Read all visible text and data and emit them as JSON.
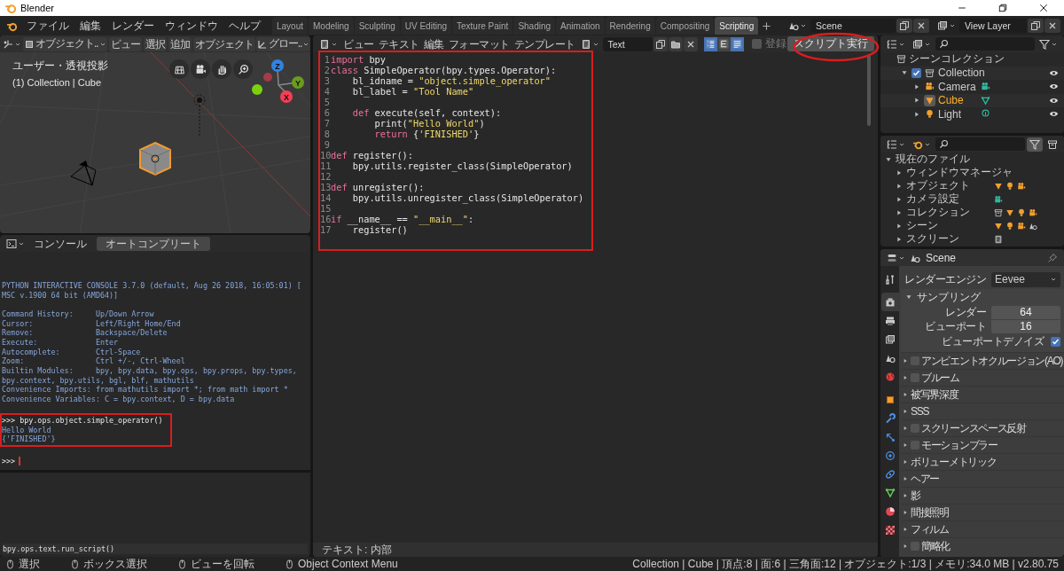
{
  "window": {
    "title": "Blender"
  },
  "menu": [
    "ファイル",
    "編集",
    "レンダー",
    "ウィンドウ",
    "ヘルプ"
  ],
  "workspace_tabs": [
    {
      "label": "Layout",
      "selected": false
    },
    {
      "label": "Modeling",
      "selected": false
    },
    {
      "label": "Sculpting",
      "selected": false
    },
    {
      "label": "UV Editing",
      "selected": false
    },
    {
      "label": "Texture Paint",
      "selected": false
    },
    {
      "label": "Shading",
      "selected": false
    },
    {
      "label": "Animation",
      "selected": false
    },
    {
      "label": "Rendering",
      "selected": false
    },
    {
      "label": "Compositing",
      "selected": false
    },
    {
      "label": "Scripting",
      "selected": true
    }
  ],
  "scene": {
    "value": "Scene"
  },
  "view_layer": {
    "value": "View Layer"
  },
  "viewport": {
    "mode": "オブジェクト..",
    "menu": [
      "ビュー",
      "選択",
      "追加",
      "オブジェクト"
    ],
    "orientation": "グロー..",
    "view_name": "ユーザー・透視投影",
    "context": "(1) Collection | Cube",
    "axes": [
      "Z",
      "Y",
      "X"
    ]
  },
  "console": {
    "menu": "コンソール",
    "button": "オートコンプリート",
    "banner": [
      "PYTHON INTERACTIVE CONSOLE 3.7.0 (default, Aug 26 2018, 16:05:01) [",
      "MSC v.1900 64 bit (AMD64)]"
    ],
    "help": [
      "Command History:     Up/Down Arrow",
      "Cursor:              Left/Right Home/End",
      "Remove:              Backspace/Delete",
      "Execute:             Enter",
      "Autocomplete:        Ctrl-Space",
      "Zoom:                Ctrl +/-, Ctrl-Wheel",
      "Builtin Modules:     bpy, bpy.data, bpy.ops, bpy.props, bpy.types,",
      "bpy.context, bpy.utils, bgl, blf, mathutils",
      "Convenience Imports: from mathutils import *; from math import *",
      "Convenience Variables: C = bpy.context, D = bpy.data"
    ],
    "output": [
      {
        "text": ">>> bpy.ops.object.simple_operator()",
        "kind": "input"
      },
      {
        "text": "Hello World",
        "kind": "output"
      },
      {
        "text": "{'FINISHED'}",
        "kind": "output"
      }
    ],
    "prompt": ">>>"
  },
  "info": {
    "report": "bpy.ops.text.run_script()"
  },
  "text_editor": {
    "menu": [
      "ビュー",
      "テキスト",
      "編集",
      "フォーマット",
      "テンプレート"
    ],
    "text_name": "Text",
    "toggles": [
      {
        "selected": true
      },
      {
        "selected": false
      },
      {
        "selected": true
      }
    ],
    "register": {
      "label": "登録",
      "checked": false
    },
    "run_button": "スクリプト実行",
    "lines": [
      {
        "number": "1",
        "tokens": [
          {
            "text": "import",
            "kind": "keyword"
          },
          {
            "text": " bpy",
            "kind": "plain"
          }
        ]
      },
      {
        "number": "2",
        "tokens": [
          {
            "text": "class",
            "kind": "keyword"
          },
          {
            "text": " SimpleOperator(bpy.types.Operator):",
            "kind": "plain"
          }
        ]
      },
      {
        "number": "3",
        "tokens": [
          {
            "text": "    bl_idname = ",
            "kind": "plain"
          },
          {
            "text": "\"object.simple_operator\"",
            "kind": "string"
          }
        ]
      },
      {
        "number": "4",
        "tokens": [
          {
            "text": "    bl_label = ",
            "kind": "plain"
          },
          {
            "text": "\"Tool Name\"",
            "kind": "string"
          }
        ]
      },
      {
        "number": "5"
      },
      {
        "number": "6",
        "tokens": [
          {
            "text": "    def",
            "kind": "keyword"
          },
          {
            "text": " execute(self, context):",
            "kind": "plain"
          }
        ]
      },
      {
        "number": "7",
        "tokens": [
          {
            "text": "        print(",
            "kind": "plain"
          },
          {
            "text": "\"Hello World\"",
            "kind": "string"
          },
          {
            "text": ")",
            "kind": "plain"
          }
        ]
      },
      {
        "number": "8",
        "tokens": [
          {
            "text": "        return",
            "kind": "keyword"
          },
          {
            "text": " {",
            "kind": "plain"
          },
          {
            "text": "'FINISHED'",
            "kind": "string"
          },
          {
            "text": "}",
            "kind": "plain"
          }
        ]
      },
      {
        "number": "9"
      },
      {
        "number": "10",
        "tokens": [
          {
            "text": "def",
            "kind": "keyword"
          },
          {
            "text": " register():",
            "kind": "plain"
          }
        ]
      },
      {
        "number": "11",
        "tokens": [
          {
            "text": "    bpy.utils.register_class(SimpleOperator)",
            "kind": "plain"
          }
        ]
      },
      {
        "number": "12"
      },
      {
        "number": "13",
        "tokens": [
          {
            "text": "def",
            "kind": "keyword"
          },
          {
            "text": " unregister():",
            "kind": "plain"
          }
        ]
      },
      {
        "number": "14",
        "tokens": [
          {
            "text": "    bpy.utils.unregister_class(SimpleOperator)",
            "kind": "plain"
          }
        ]
      },
      {
        "number": "15"
      },
      {
        "number": "16",
        "tokens": [
          {
            "text": "if",
            "kind": "keyword"
          },
          {
            "text": " __name__ == ",
            "kind": "plain"
          },
          {
            "text": "\"__main__\"",
            "kind": "string"
          },
          {
            "text": ":",
            "kind": "plain"
          }
        ]
      },
      {
        "number": "17",
        "tokens": [
          {
            "text": "    register()",
            "kind": "plain"
          }
        ]
      }
    ],
    "footer": "テキスト: 内部"
  },
  "outliner": {
    "root": "シーンコレクション",
    "items": [
      {
        "label": "Collection",
        "checked": true,
        "expanded": true,
        "children": [
          {
            "label": "Camera",
            "kind": "camera",
            "selected": false,
            "expanded": false
          },
          {
            "label": "Cube",
            "kind": "mesh",
            "selected": true,
            "expanded": false
          },
          {
            "label": "Light",
            "kind": "light",
            "selected": false,
            "expanded": false
          }
        ]
      }
    ]
  },
  "blend_file": {
    "root": "現在のファイル",
    "expanded": true,
    "items": [
      {
        "label": "ウィンドウマネージャ",
        "expanded": false
      },
      {
        "label": "オブジェクト",
        "expanded": false
      },
      {
        "label": "カメラ設定",
        "expanded": false
      },
      {
        "label": "コレクション",
        "expanded": false
      },
      {
        "label": "シーン",
        "expanded": false
      },
      {
        "label": "スクリーン",
        "expanded": false
      }
    ]
  },
  "properties": {
    "context": "Scene",
    "tabs": [
      {
        "selected": false
      },
      {
        "selected": true
      },
      {
        "selected": false
      },
      {
        "selected": false
      },
      {
        "selected": false
      },
      {
        "selected": false
      },
      {
        "selected": false
      },
      {
        "selected": false
      },
      {
        "selected": false
      },
      {
        "selected": false
      },
      {
        "selected": false
      },
      {
        "selected": false
      },
      {
        "selected": false
      },
      {
        "selected": false
      }
    ],
    "render_engine": {
      "label": "レンダーエンジン",
      "value": "Eevee"
    },
    "sampling": {
      "title": "サンプリング",
      "expanded": true,
      "fields": [
        {
          "label": "レンダー",
          "value": "64"
        },
        {
          "label": "ビューポート",
          "value": "16"
        }
      ],
      "denoise": {
        "label": "ビューポートデノイズ",
        "checked": true
      }
    },
    "panels": [
      {
        "title": "アンビエントオクルージョン(AO)",
        "kind": "toggle",
        "checked": false
      },
      {
        "title": "ブルーム",
        "kind": "toggle",
        "checked": false
      },
      {
        "title": "被写界深度",
        "kind": "plain"
      },
      {
        "title": "SSS",
        "kind": "plain"
      },
      {
        "title": "スクリーンスペース反射",
        "kind": "toggle",
        "checked": false
      },
      {
        "title": "モーションブラー",
        "kind": "toggle",
        "checked": false
      },
      {
        "title": "ボリューメトリック",
        "kind": "plain"
      },
      {
        "title": "ヘアー",
        "kind": "plain"
      },
      {
        "title": "影",
        "kind": "plain"
      },
      {
        "title": "間接照明",
        "kind": "plain"
      },
      {
        "title": "フィルム",
        "kind": "plain"
      },
      {
        "title": "簡略化",
        "kind": "toggle",
        "checked": false
      }
    ]
  },
  "status_bar": {
    "hints": [
      "選択",
      "ボックス選択",
      "ビューを回転",
      "Object Context Menu"
    ],
    "stats": "Collection | Cube | 頂点:8 | 面:6 | 三角面:12 | オブジェクト:1/3 | メモリ:34.0 MB | v2.80.75"
  }
}
